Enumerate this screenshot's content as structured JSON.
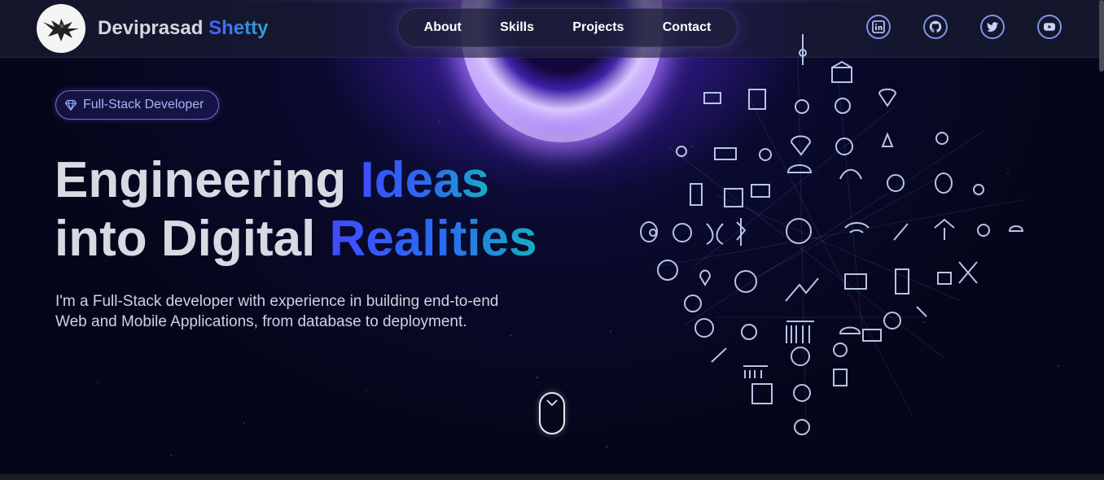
{
  "header": {
    "brand_first": "Deviprasad",
    "brand_second": "Shetty",
    "nav": [
      "About",
      "Skills",
      "Projects",
      "Contact"
    ],
    "socials": [
      "linkedin-icon",
      "github-icon",
      "twitter-icon",
      "youtube-icon"
    ]
  },
  "hero": {
    "badge": "Full-Stack Developer",
    "headline_line1_plain": "Engineering",
    "headline_line1_accent": "Ideas",
    "headline_line2_plain": "into Digital",
    "headline_line2_accent": "Realities",
    "subtitle": "I'm a Full-Stack developer with experience in building end-to-end Web and Mobile Applications, from database to deployment."
  },
  "colors": {
    "accent_start": "#3f4cff",
    "accent_end": "#16b0c0",
    "background": "#05061a",
    "badge_text": "#a9b3f5"
  }
}
